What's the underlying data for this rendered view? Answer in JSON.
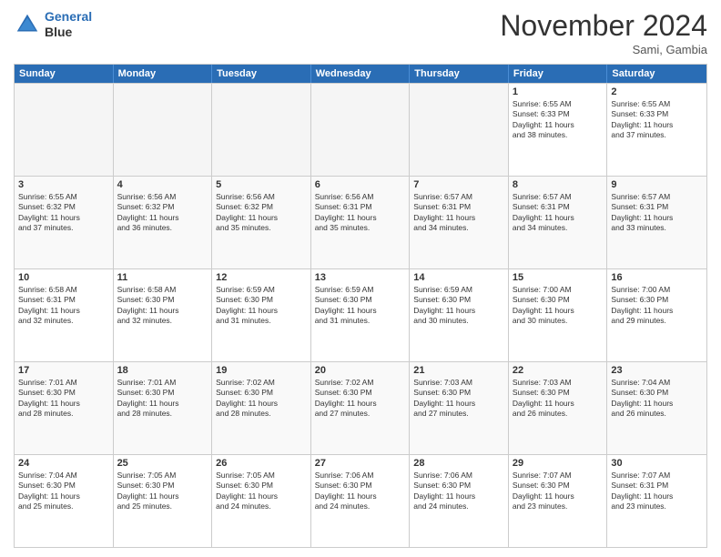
{
  "header": {
    "logo_line1": "General",
    "logo_line2": "Blue",
    "month": "November 2024",
    "location": "Sami, Gambia"
  },
  "weekdays": [
    "Sunday",
    "Monday",
    "Tuesday",
    "Wednesday",
    "Thursday",
    "Friday",
    "Saturday"
  ],
  "rows": [
    [
      {
        "day": "",
        "empty": true
      },
      {
        "day": "",
        "empty": true
      },
      {
        "day": "",
        "empty": true
      },
      {
        "day": "",
        "empty": true
      },
      {
        "day": "",
        "empty": true
      },
      {
        "day": "1",
        "lines": [
          "Sunrise: 6:55 AM",
          "Sunset: 6:33 PM",
          "Daylight: 11 hours",
          "and 38 minutes."
        ]
      },
      {
        "day": "2",
        "lines": [
          "Sunrise: 6:55 AM",
          "Sunset: 6:33 PM",
          "Daylight: 11 hours",
          "and 37 minutes."
        ]
      }
    ],
    [
      {
        "day": "3",
        "lines": [
          "Sunrise: 6:55 AM",
          "Sunset: 6:32 PM",
          "Daylight: 11 hours",
          "and 37 minutes."
        ]
      },
      {
        "day": "4",
        "lines": [
          "Sunrise: 6:56 AM",
          "Sunset: 6:32 PM",
          "Daylight: 11 hours",
          "and 36 minutes."
        ]
      },
      {
        "day": "5",
        "lines": [
          "Sunrise: 6:56 AM",
          "Sunset: 6:32 PM",
          "Daylight: 11 hours",
          "and 35 minutes."
        ]
      },
      {
        "day": "6",
        "lines": [
          "Sunrise: 6:56 AM",
          "Sunset: 6:31 PM",
          "Daylight: 11 hours",
          "and 35 minutes."
        ]
      },
      {
        "day": "7",
        "lines": [
          "Sunrise: 6:57 AM",
          "Sunset: 6:31 PM",
          "Daylight: 11 hours",
          "and 34 minutes."
        ]
      },
      {
        "day": "8",
        "lines": [
          "Sunrise: 6:57 AM",
          "Sunset: 6:31 PM",
          "Daylight: 11 hours",
          "and 34 minutes."
        ]
      },
      {
        "day": "9",
        "lines": [
          "Sunrise: 6:57 AM",
          "Sunset: 6:31 PM",
          "Daylight: 11 hours",
          "and 33 minutes."
        ]
      }
    ],
    [
      {
        "day": "10",
        "lines": [
          "Sunrise: 6:58 AM",
          "Sunset: 6:31 PM",
          "Daylight: 11 hours",
          "and 32 minutes."
        ]
      },
      {
        "day": "11",
        "lines": [
          "Sunrise: 6:58 AM",
          "Sunset: 6:30 PM",
          "Daylight: 11 hours",
          "and 32 minutes."
        ]
      },
      {
        "day": "12",
        "lines": [
          "Sunrise: 6:59 AM",
          "Sunset: 6:30 PM",
          "Daylight: 11 hours",
          "and 31 minutes."
        ]
      },
      {
        "day": "13",
        "lines": [
          "Sunrise: 6:59 AM",
          "Sunset: 6:30 PM",
          "Daylight: 11 hours",
          "and 31 minutes."
        ]
      },
      {
        "day": "14",
        "lines": [
          "Sunrise: 6:59 AM",
          "Sunset: 6:30 PM",
          "Daylight: 11 hours",
          "and 30 minutes."
        ]
      },
      {
        "day": "15",
        "lines": [
          "Sunrise: 7:00 AM",
          "Sunset: 6:30 PM",
          "Daylight: 11 hours",
          "and 30 minutes."
        ]
      },
      {
        "day": "16",
        "lines": [
          "Sunrise: 7:00 AM",
          "Sunset: 6:30 PM",
          "Daylight: 11 hours",
          "and 29 minutes."
        ]
      }
    ],
    [
      {
        "day": "17",
        "lines": [
          "Sunrise: 7:01 AM",
          "Sunset: 6:30 PM",
          "Daylight: 11 hours",
          "and 28 minutes."
        ]
      },
      {
        "day": "18",
        "lines": [
          "Sunrise: 7:01 AM",
          "Sunset: 6:30 PM",
          "Daylight: 11 hours",
          "and 28 minutes."
        ]
      },
      {
        "day": "19",
        "lines": [
          "Sunrise: 7:02 AM",
          "Sunset: 6:30 PM",
          "Daylight: 11 hours",
          "and 28 minutes."
        ]
      },
      {
        "day": "20",
        "lines": [
          "Sunrise: 7:02 AM",
          "Sunset: 6:30 PM",
          "Daylight: 11 hours",
          "and 27 minutes."
        ]
      },
      {
        "day": "21",
        "lines": [
          "Sunrise: 7:03 AM",
          "Sunset: 6:30 PM",
          "Daylight: 11 hours",
          "and 27 minutes."
        ]
      },
      {
        "day": "22",
        "lines": [
          "Sunrise: 7:03 AM",
          "Sunset: 6:30 PM",
          "Daylight: 11 hours",
          "and 26 minutes."
        ]
      },
      {
        "day": "23",
        "lines": [
          "Sunrise: 7:04 AM",
          "Sunset: 6:30 PM",
          "Daylight: 11 hours",
          "and 26 minutes."
        ]
      }
    ],
    [
      {
        "day": "24",
        "lines": [
          "Sunrise: 7:04 AM",
          "Sunset: 6:30 PM",
          "Daylight: 11 hours",
          "and 25 minutes."
        ]
      },
      {
        "day": "25",
        "lines": [
          "Sunrise: 7:05 AM",
          "Sunset: 6:30 PM",
          "Daylight: 11 hours",
          "and 25 minutes."
        ]
      },
      {
        "day": "26",
        "lines": [
          "Sunrise: 7:05 AM",
          "Sunset: 6:30 PM",
          "Daylight: 11 hours",
          "and 24 minutes."
        ]
      },
      {
        "day": "27",
        "lines": [
          "Sunrise: 7:06 AM",
          "Sunset: 6:30 PM",
          "Daylight: 11 hours",
          "and 24 minutes."
        ]
      },
      {
        "day": "28",
        "lines": [
          "Sunrise: 7:06 AM",
          "Sunset: 6:30 PM",
          "Daylight: 11 hours",
          "and 24 minutes."
        ]
      },
      {
        "day": "29",
        "lines": [
          "Sunrise: 7:07 AM",
          "Sunset: 6:30 PM",
          "Daylight: 11 hours",
          "and 23 minutes."
        ]
      },
      {
        "day": "30",
        "lines": [
          "Sunrise: 7:07 AM",
          "Sunset: 6:31 PM",
          "Daylight: 11 hours",
          "and 23 minutes."
        ]
      }
    ]
  ]
}
